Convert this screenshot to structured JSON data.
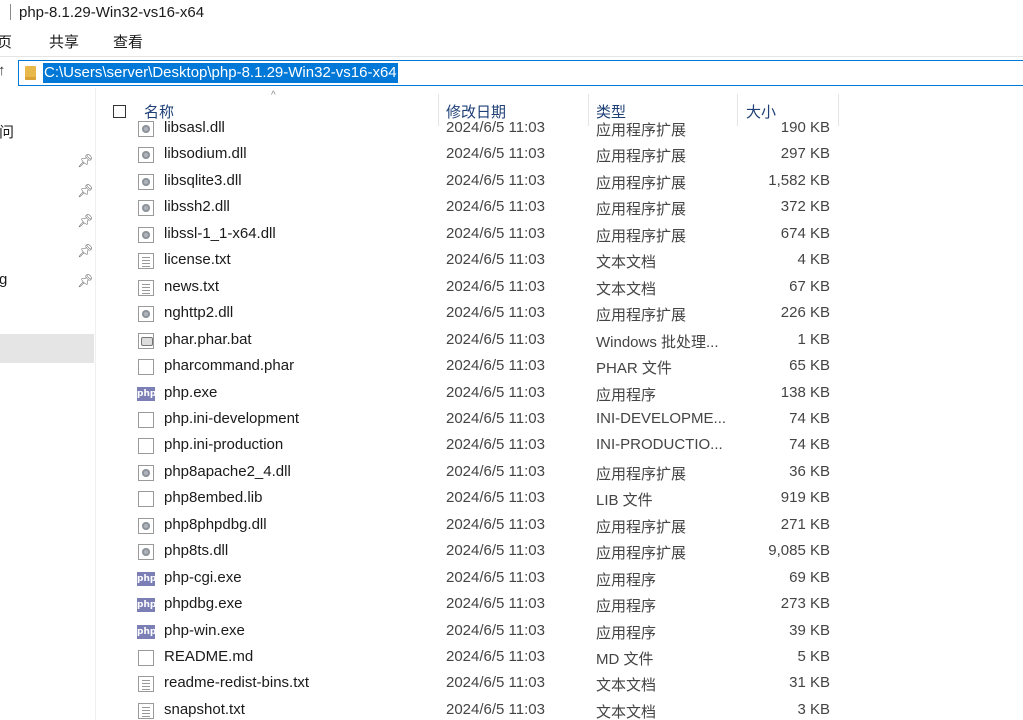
{
  "window": {
    "title": "php-8.1.29-Win32-vs16-x64"
  },
  "ribbon": {
    "tabs": [
      "页",
      "共享",
      "查看"
    ]
  },
  "address": {
    "path": "C:\\Users\\server\\Desktop\\php-8.1.29-Win32-vs16-x64"
  },
  "nav": {
    "items": [
      {
        "label": "问",
        "pinned": false
      },
      {
        "label": "",
        "pinned": true
      },
      {
        "label": "",
        "pinned": true
      },
      {
        "label": "",
        "pinned": true
      },
      {
        "label": "",
        "pinned": true
      },
      {
        "label": "g",
        "pinned": true
      }
    ]
  },
  "columns": {
    "name": "名称",
    "date": "修改日期",
    "type": "类型",
    "size": "大小"
  },
  "files": [
    {
      "name": "libsasl.dll",
      "date": "2024/6/5 11:03",
      "type": "应用程序扩展",
      "size": "190 KB",
      "icon": "dll"
    },
    {
      "name": "libsodium.dll",
      "date": "2024/6/5 11:03",
      "type": "应用程序扩展",
      "size": "297 KB",
      "icon": "dll"
    },
    {
      "name": "libsqlite3.dll",
      "date": "2024/6/5 11:03",
      "type": "应用程序扩展",
      "size": "1,582 KB",
      "icon": "dll"
    },
    {
      "name": "libssh2.dll",
      "date": "2024/6/5 11:03",
      "type": "应用程序扩展",
      "size": "372 KB",
      "icon": "dll"
    },
    {
      "name": "libssl-1_1-x64.dll",
      "date": "2024/6/5 11:03",
      "type": "应用程序扩展",
      "size": "674 KB",
      "icon": "dll"
    },
    {
      "name": "license.txt",
      "date": "2024/6/5 11:03",
      "type": "文本文档",
      "size": "4 KB",
      "icon": "txt"
    },
    {
      "name": "news.txt",
      "date": "2024/6/5 11:03",
      "type": "文本文档",
      "size": "67 KB",
      "icon": "txt"
    },
    {
      "name": "nghttp2.dll",
      "date": "2024/6/5 11:03",
      "type": "应用程序扩展",
      "size": "226 KB",
      "icon": "dll"
    },
    {
      "name": "phar.phar.bat",
      "date": "2024/6/5 11:03",
      "type": "Windows 批处理...",
      "size": "1 KB",
      "icon": "bat"
    },
    {
      "name": "pharcommand.phar",
      "date": "2024/6/5 11:03",
      "type": "PHAR 文件",
      "size": "65 KB",
      "icon": "blank"
    },
    {
      "name": "php.exe",
      "date": "2024/6/5 11:03",
      "type": "应用程序",
      "size": "138 KB",
      "icon": "php"
    },
    {
      "name": "php.ini-development",
      "date": "2024/6/5 11:03",
      "type": "INI-DEVELOPME...",
      "size": "74 KB",
      "icon": "blank"
    },
    {
      "name": "php.ini-production",
      "date": "2024/6/5 11:03",
      "type": "INI-PRODUCTIO...",
      "size": "74 KB",
      "icon": "blank"
    },
    {
      "name": "php8apache2_4.dll",
      "date": "2024/6/5 11:03",
      "type": "应用程序扩展",
      "size": "36 KB",
      "icon": "dll"
    },
    {
      "name": "php8embed.lib",
      "date": "2024/6/5 11:03",
      "type": "LIB 文件",
      "size": "919 KB",
      "icon": "blank"
    },
    {
      "name": "php8phpdbg.dll",
      "date": "2024/6/5 11:03",
      "type": "应用程序扩展",
      "size": "271 KB",
      "icon": "dll"
    },
    {
      "name": "php8ts.dll",
      "date": "2024/6/5 11:03",
      "type": "应用程序扩展",
      "size": "9,085 KB",
      "icon": "dll"
    },
    {
      "name": "php-cgi.exe",
      "date": "2024/6/5 11:03",
      "type": "应用程序",
      "size": "69 KB",
      "icon": "php"
    },
    {
      "name": "phpdbg.exe",
      "date": "2024/6/5 11:03",
      "type": "应用程序",
      "size": "273 KB",
      "icon": "php"
    },
    {
      "name": "php-win.exe",
      "date": "2024/6/5 11:03",
      "type": "应用程序",
      "size": "39 KB",
      "icon": "php"
    },
    {
      "name": "README.md",
      "date": "2024/6/5 11:03",
      "type": "MD 文件",
      "size": "5 KB",
      "icon": "blank"
    },
    {
      "name": "readme-redist-bins.txt",
      "date": "2024/6/5 11:03",
      "type": "文本文档",
      "size": "31 KB",
      "icon": "txt"
    },
    {
      "name": "snapshot.txt",
      "date": "2024/6/5 11:03",
      "type": "文本文档",
      "size": "3 KB",
      "icon": "txt"
    }
  ],
  "icon_names": {
    "php": "php-exe-icon",
    "dll": "dll-file-icon",
    "txt": "text-file-icon",
    "blank": "blank-file-icon",
    "bat": "batch-file-icon"
  },
  "colors": {
    "accent": "#0078d7",
    "header_text": "#1e3f76",
    "selected_nav": "#e5e5e5"
  }
}
